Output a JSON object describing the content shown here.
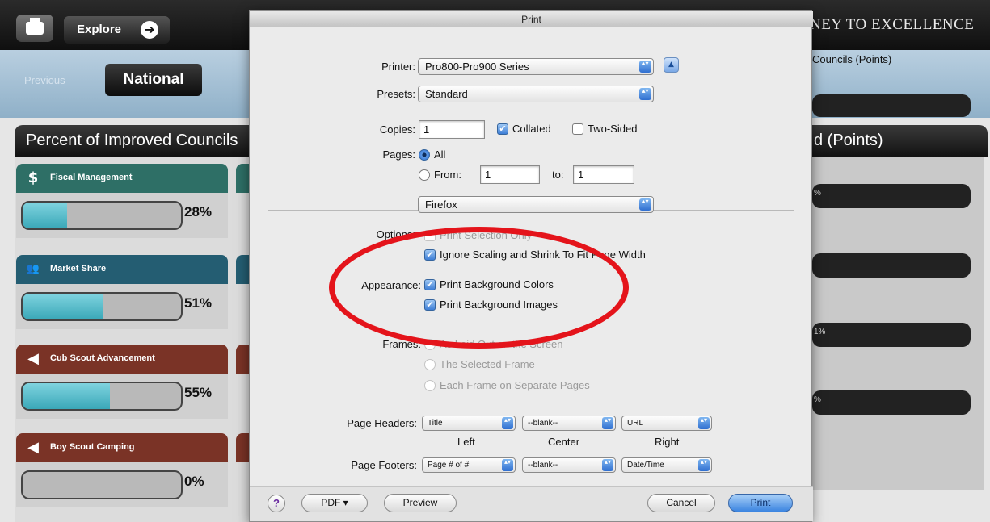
{
  "background_page": {
    "explore_label": "Explore",
    "explore_arrow_glyph": "➔",
    "brand_text": "NEY TO EXCELLENCE",
    "previous_label": "Previous",
    "national_tab": "National",
    "right_title": "Councils (Points)",
    "left_panel_title": "Percent of Improved Councils",
    "right_panel_title": "d (Points)",
    "right_meter_values": [
      "%",
      "",
      "1%",
      "%"
    ],
    "cards": [
      {
        "title": "Fiscal Management",
        "icon": "dollar-icon",
        "glyph": "$",
        "percent_text": "28%",
        "fill": 0.28,
        "color": "#2e6f66"
      },
      {
        "title": "Market Share",
        "icon": "people-icon",
        "glyph": "👥",
        "percent_text": "51%",
        "fill": 0.51,
        "color": "#245d72"
      },
      {
        "title": "Cub Scout Advancement",
        "icon": "advancement-icon",
        "glyph": "◀",
        "percent_text": "55%",
        "fill": 0.55,
        "color": "#7a3326"
      },
      {
        "title": "Boy Scout Camping",
        "icon": "camping-icon",
        "glyph": "◀",
        "percent_text": "0%",
        "fill": 0.0,
        "color": "#7a3326"
      }
    ]
  },
  "dialog": {
    "title": "Print",
    "printer_label": "Printer:",
    "printer_value": "Pro800-Pro900 Series",
    "presets_label": "Presets:",
    "presets_value": "Standard",
    "copies_label": "Copies:",
    "copies_value": "1",
    "collated_label": "Collated",
    "two_sided_label": "Two-Sided",
    "pages_label": "Pages:",
    "all_label": "All",
    "from_label": "From:",
    "from_value": "1",
    "to_label": "to:",
    "to_value": "1",
    "section_value": "Firefox",
    "options_label": "Options:",
    "selection_only_label": "Print Selection Only",
    "ignore_scaling_label": "Ignore Scaling and Shrink To Fit Page Width",
    "appearance_label": "Appearance:",
    "bg_colors_label": "Print Background Colors",
    "bg_images_label": "Print Background Images",
    "frames_label": "Frames:",
    "frame_opt1": "As Laid Out on the Screen",
    "frame_opt2": "The Selected Frame",
    "frame_opt3": "Each Frame on Separate Pages",
    "headers_label": "Page Headers:",
    "header_left": "Title",
    "header_center": "--blank--",
    "header_right": "URL",
    "col_left": "Left",
    "col_center": "Center",
    "col_right": "Right",
    "footers_label": "Page Footers:",
    "footer_left": "Page # of #",
    "footer_center": "--blank--",
    "footer_right": "Date/Time",
    "help_glyph": "?",
    "pdf_label": "PDF ▾",
    "preview_label": "Preview",
    "cancel_label": "Cancel",
    "print_label": "Print",
    "popup_arrows_glyph": "▴▾",
    "disclosure_glyph": "▲",
    "check_glyph": "✔"
  },
  "colors": {
    "accent_blue": "#3b84e0",
    "annotation_red": "#e4141b"
  }
}
